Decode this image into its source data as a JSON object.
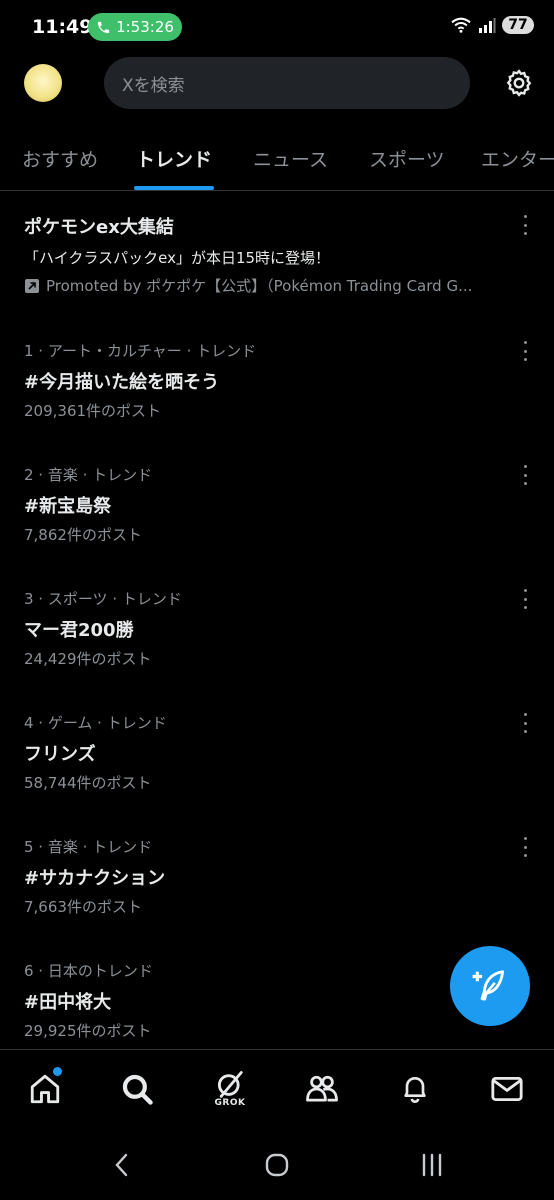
{
  "status": {
    "time": "11:49",
    "call_timer": "1:53:26",
    "battery": "77"
  },
  "search": {
    "placeholder": "Xを検索"
  },
  "tabs": [
    {
      "label": "おすすめ",
      "active": false
    },
    {
      "label": "トレンド",
      "active": true
    },
    {
      "label": "ニュース",
      "active": false
    },
    {
      "label": "スポーツ",
      "active": false
    },
    {
      "label": "エンター",
      "active": false
    }
  ],
  "promoted": {
    "title": "ポケモンex大集結",
    "description": "「ハイクラスパックex」が本日15時に登場！",
    "promoted_by": "Promoted by ポケポケ【公式】（Pokémon Trading Card G..."
  },
  "trends": [
    {
      "meta": "1 · アート・カルチャー · トレンド",
      "title": "#今月描いた絵を晒そう",
      "count": "209,361件のポスト"
    },
    {
      "meta": "2 · 音楽 · トレンド",
      "title": "#新宝島祭",
      "count": "7,862件のポスト"
    },
    {
      "meta": "3 · スポーツ · トレンド",
      "title": "マー君200勝",
      "count": "24,429件のポスト"
    },
    {
      "meta": "4 · ゲーム · トレンド",
      "title": "フリンズ",
      "count": "58,744件のポスト"
    },
    {
      "meta": "5 · 音楽 · トレンド",
      "title": "#サカナクション",
      "count": "7,663件のポスト"
    },
    {
      "meta": "6 · 日本のトレンド",
      "title": "#田中将大",
      "count": "29,925件のポスト"
    }
  ],
  "bottom_nav": {
    "grok_label": "GROK"
  },
  "colors": {
    "accent": "#1d9bf0",
    "background": "#000000",
    "call_pill": "#3fbf6a"
  },
  "icons": [
    "phone-icon",
    "wifi-icon",
    "signal-icon",
    "gear-icon",
    "more-icon",
    "promoted-icon",
    "compose-icon",
    "home-icon",
    "search-icon",
    "grok-icon",
    "communities-icon",
    "bell-icon",
    "mail-icon",
    "back-icon",
    "home-circle-icon",
    "recents-icon"
  ]
}
